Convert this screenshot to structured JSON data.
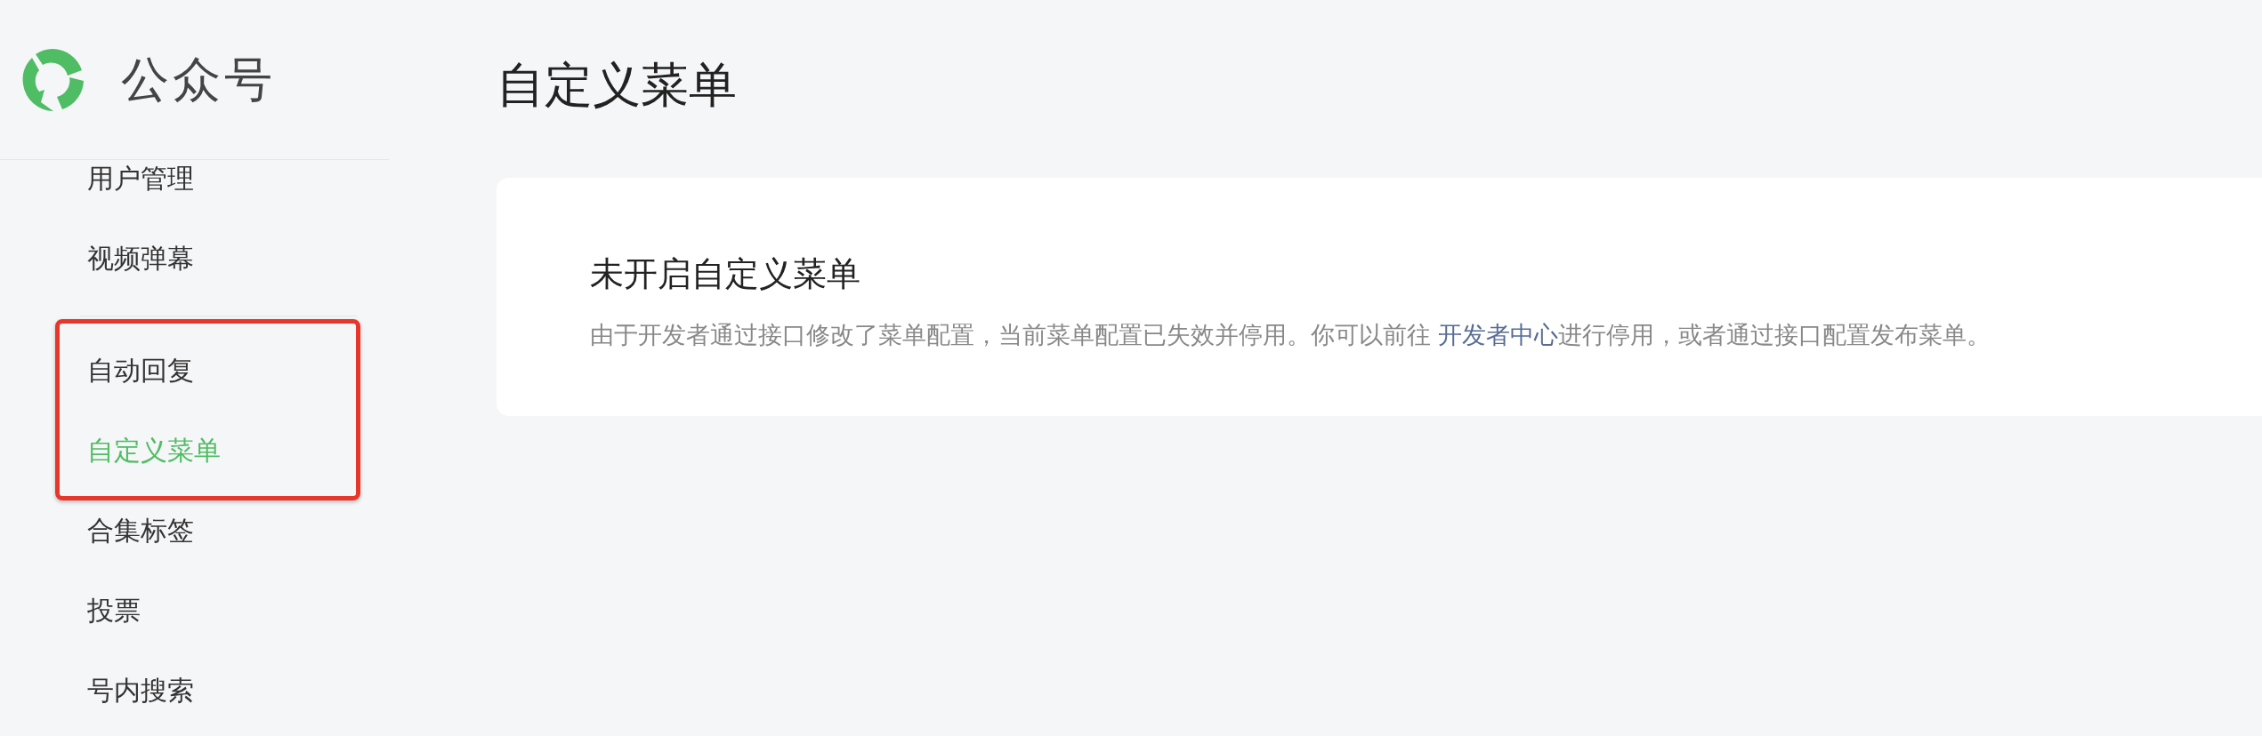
{
  "brand": {
    "title": "公众号"
  },
  "sidebar": {
    "groups": [
      {
        "items": [
          {
            "label": "用户管理",
            "selected": false,
            "highlighted": false
          },
          {
            "label": "视频弹幕",
            "selected": false,
            "highlighted": false
          }
        ]
      },
      {
        "items": [
          {
            "label": "自动回复",
            "selected": false,
            "highlighted": true
          },
          {
            "label": "自定义菜单",
            "selected": true,
            "highlighted": true
          },
          {
            "label": "合集标签",
            "selected": false,
            "highlighted": false
          },
          {
            "label": "投票",
            "selected": false,
            "highlighted": false
          },
          {
            "label": "号内搜索",
            "selected": false,
            "highlighted": false
          }
        ]
      }
    ]
  },
  "page": {
    "title": "自定义菜单"
  },
  "notice": {
    "title": "未开启自定义菜单",
    "text_before": "由于开发者通过接口修改了菜单配置，当前菜单配置已失效并停用。你可以前往 ",
    "link": "开发者中心",
    "text_after": "进行停用，或者通过接口配置发布菜单。"
  }
}
